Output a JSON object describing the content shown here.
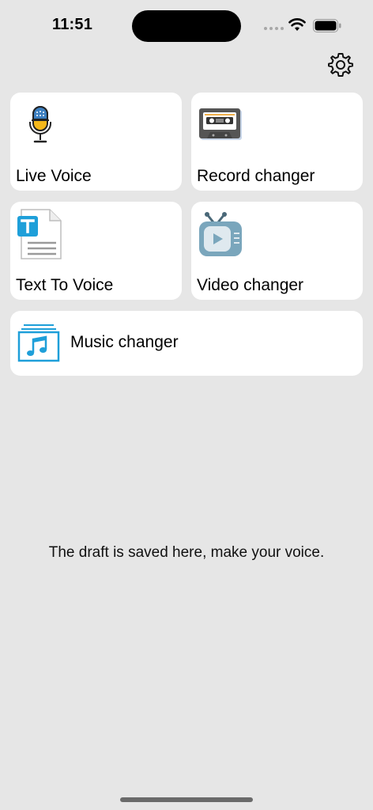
{
  "status_bar": {
    "time": "11:51"
  },
  "tiles": [
    {
      "label": "Live Voice",
      "icon": "microphone-icon"
    },
    {
      "label": "Record changer",
      "icon": "cassette-tape-icon"
    },
    {
      "label": "Text To Voice",
      "icon": "text-document-icon"
    },
    {
      "label": "Video changer",
      "icon": "retro-tv-icon"
    },
    {
      "label": "Music changer",
      "icon": "music-note-icon"
    }
  ],
  "settings_icon": "gear-icon",
  "empty_state": {
    "message": "The draft is saved here, make your voice."
  },
  "colors": {
    "background": "#e6e6e6",
    "tile": "#ffffff",
    "accent_blue": "#1e9fd9",
    "mic_yellow": "#f3b71b"
  }
}
